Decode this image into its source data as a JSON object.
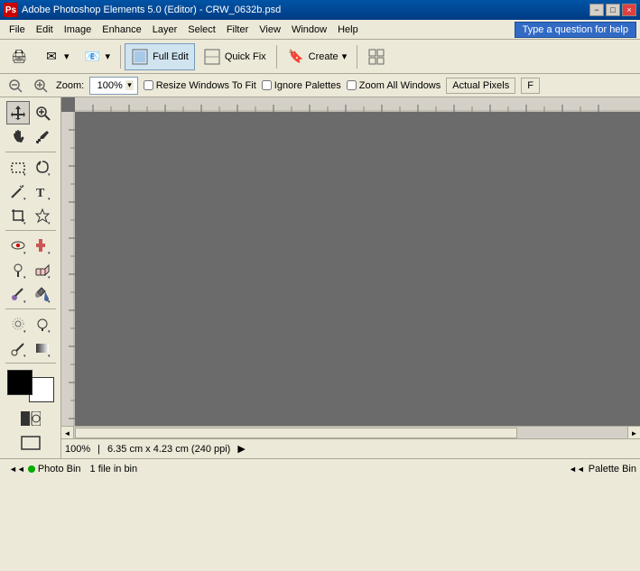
{
  "titlebar": {
    "app_icon": "Ps",
    "title": "Adobe Photoshop Elements 5.0 (Editor) - CRW_0632b.psd",
    "min_label": "−",
    "max_label": "□",
    "close_label": "×",
    "inner_min": "−",
    "inner_max": "□",
    "inner_close": "×"
  },
  "menubar": {
    "items": [
      "File",
      "Edit",
      "Image",
      "Enhance",
      "Layer",
      "Select",
      "Filter",
      "View",
      "Window",
      "Help"
    ],
    "search_placeholder": "Type a question for help"
  },
  "toolbar": {
    "full_edit": "Full Edit",
    "quick_fix": "Quick Fix",
    "print_label": "",
    "add_label": "",
    "create_label": "Create",
    "palette_grid_label": ""
  },
  "options_bar": {
    "zoom_label": "Zoom:",
    "zoom_value": "100%",
    "resize_windows_label": "Resize Windows To Fit",
    "ignore_palettes_label": "Ignore Palettes",
    "zoom_all_label": "Zoom All Windows",
    "actual_pixels_label": "Actual Pixels",
    "fit_screen_label": "F"
  },
  "tools": [
    {
      "name": "move",
      "icon": "✥"
    },
    {
      "name": "zoom",
      "icon": "🔍"
    },
    {
      "name": "hand",
      "icon": "✋"
    },
    {
      "name": "eye-dropper",
      "icon": "💉"
    },
    {
      "name": "selection-marquee",
      "icon": "⬜"
    },
    {
      "name": "lasso",
      "icon": "🔗"
    },
    {
      "name": "magic-wand",
      "icon": "🪄"
    },
    {
      "name": "text",
      "icon": "T"
    },
    {
      "name": "crop",
      "icon": "⊡"
    },
    {
      "name": "cookie-cutter",
      "icon": "✂"
    },
    {
      "name": "redeye",
      "icon": "👁"
    },
    {
      "name": "stamp",
      "icon": "📋"
    },
    {
      "name": "eraser",
      "icon": "◻"
    },
    {
      "name": "brush",
      "icon": "🖌"
    },
    {
      "name": "paint-bucket",
      "icon": "🪣"
    },
    {
      "name": "smudge",
      "icon": "〰"
    },
    {
      "name": "sharpen",
      "icon": "△"
    },
    {
      "name": "healing",
      "icon": "✚"
    },
    {
      "name": "dodge",
      "icon": "○"
    },
    {
      "name": "blur",
      "icon": "◌"
    },
    {
      "name": "gradient",
      "icon": "▦"
    },
    {
      "name": "shape",
      "icon": "◇"
    },
    {
      "name": "eyedropper2",
      "icon": "⊕"
    },
    {
      "name": "pencil",
      "icon": "✏"
    }
  ],
  "status": {
    "zoom": "100%",
    "dimensions": "6.35 cm x 4.23 cm (240 ppi)",
    "arrow_label": "▶"
  },
  "bottom": {
    "photo_bin_label": "Photo Bin",
    "indicator_color": "#00aa00",
    "file_count": "1 file in bin",
    "palette_bin_label": "Palette Bin"
  },
  "colors": {
    "background": "#ece9d8",
    "toolbar_bg": "#ece9d8",
    "title_bar": "#0054a6",
    "active_tab": "#d0e4f0",
    "canvas_bg": "#6b6b6b",
    "ruler_bg": "#d4d0c8"
  }
}
